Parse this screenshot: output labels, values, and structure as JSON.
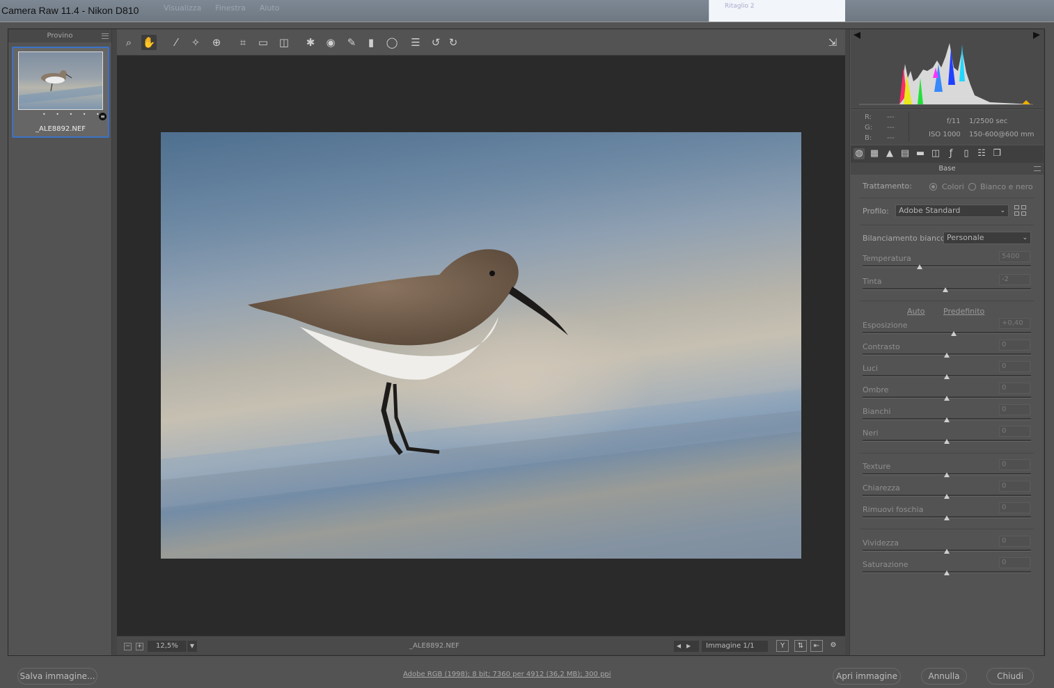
{
  "window": {
    "title": "Camera Raw 11.4  -  Nikon D810",
    "bg_menus": [
      "Visualizza",
      "Finestra",
      "Aiuto"
    ],
    "ghost_window_title": "Ritaglio 2"
  },
  "filmstrip": {
    "header": "Provino",
    "items": [
      {
        "filename": "_ALE8892.NEF",
        "rating_dots": "• • • • •"
      }
    ]
  },
  "toolbar": {
    "tools": [
      "zoom-tool",
      "hand-tool",
      "white-balance-tool",
      "color-sampler-tool",
      "targeted-adjustment-tool",
      "crop-tool",
      "straighten-tool",
      "transform-tool",
      "spot-removal-tool",
      "red-eye-tool",
      "adjustment-brush",
      "graduated-filter",
      "radial-filter",
      "presets-list",
      "rotate-left",
      "rotate-right"
    ],
    "active_tool": "hand-tool"
  },
  "status": {
    "zoom": "12,5%",
    "filename": "_ALE8892.NEF",
    "image_counter": "Immagine 1/1"
  },
  "info": {
    "r_label": "R:",
    "g_label": "G:",
    "b_label": "B:",
    "r_value": "---",
    "g_value": "---",
    "b_value": "---",
    "aperture": "f/11",
    "shutter": "1/2500 sec",
    "iso": "ISO 1000",
    "lens": "150-600@600 mm"
  },
  "panel": {
    "section_title": "Base",
    "treatment_label": "Trattamento:",
    "treatment_color": "Colori",
    "treatment_bw": "Bianco e nero",
    "treatment_selected": "Colori",
    "profile_label": "Profilo:",
    "profile_value": "Adobe Standard",
    "wb_label": "Bilanciamento bianco:",
    "wb_value": "Personale",
    "auto_link": "Auto",
    "default_link": "Predefinito",
    "sliders": [
      {
        "label": "Temperatura",
        "value": "5400",
        "position": 0.34
      },
      {
        "label": "Tinta",
        "value": "-2",
        "position": 0.49
      },
      {
        "label": "Esposizione",
        "value": "+0,40",
        "position": 0.54
      },
      {
        "label": "Contrasto",
        "value": "0",
        "position": 0.5
      },
      {
        "label": "Luci",
        "value": "0",
        "position": 0.5
      },
      {
        "label": "Ombre",
        "value": "0",
        "position": 0.5
      },
      {
        "label": "Bianchi",
        "value": "0",
        "position": 0.5
      },
      {
        "label": "Neri",
        "value": "0",
        "position": 0.5
      },
      {
        "label": "Texture",
        "value": "0",
        "position": 0.5
      },
      {
        "label": "Chiarezza",
        "value": "0",
        "position": 0.5
      },
      {
        "label": "Rimuovi foschia",
        "value": "0",
        "position": 0.5
      },
      {
        "label": "Vividezza",
        "value": "0",
        "position": 0.5
      },
      {
        "label": "Saturazione",
        "value": "0",
        "position": 0.5
      }
    ]
  },
  "bottom": {
    "save_button": "Salva immagine...",
    "workflow_link": "Adobe RGB (1998); 8 bit; 7360 per 4912 (36,2 MB); 300 ppi",
    "open_button": "Apri immagine",
    "cancel_button": "Annulla",
    "close_button": "Chiudi"
  },
  "colors": {
    "panel_bg": "#535353",
    "canvas_bg": "#2a2a2a",
    "selection_blue": "#3b72c9"
  }
}
